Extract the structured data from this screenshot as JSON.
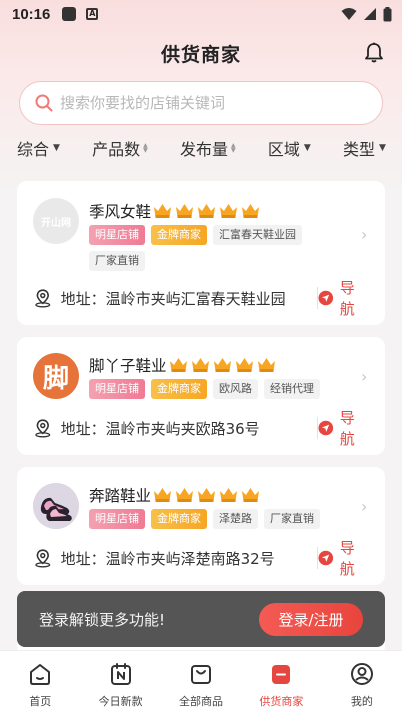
{
  "status_bar": {
    "time": "10:16"
  },
  "header": {
    "title": "供货商家"
  },
  "search": {
    "placeholder": "搜索你要找的店铺关键词"
  },
  "filters": [
    {
      "label": "综合",
      "indicator": "dropdown"
    },
    {
      "label": "产品数",
      "indicator": "sort"
    },
    {
      "label": "发布量",
      "indicator": "sort"
    },
    {
      "label": "区域",
      "indicator": "dropdown"
    },
    {
      "label": "类型",
      "indicator": "dropdown"
    }
  ],
  "shops": [
    {
      "name": "季风女鞋",
      "crowns": 5,
      "avatar_text": "开山网",
      "tags": [
        "明星店铺",
        "金牌商家",
        "汇富春天鞋业园",
        "厂家直销"
      ],
      "address_label": "地址：",
      "address": "温岭市夹屿汇富春天鞋业园",
      "nav_label": "导航"
    },
    {
      "name": "脚丫子鞋业",
      "crowns": 5,
      "avatar_text": "脚",
      "tags": [
        "明星店铺",
        "金牌商家",
        "欧风路",
        "经销代理"
      ],
      "address_label": "地址：",
      "address": "温岭市夹屿夹欧路36号",
      "nav_label": "导航"
    },
    {
      "name": "奔踏鞋业",
      "crowns": 5,
      "tags": [
        "明星店铺",
        "金牌商家",
        "泽楚路",
        "厂家直销"
      ],
      "address_label": "地址：",
      "address": "温岭市夹屿泽楚南路32号",
      "nav_label": "导航"
    }
  ],
  "toast": {
    "text": "登录解锁更多功能!",
    "button_label": "登录/注册"
  },
  "bottom_nav": [
    {
      "label": "首页",
      "icon": "home-icon"
    },
    {
      "label": "今日新款",
      "icon": "calendar-new-icon"
    },
    {
      "label": "全部商品",
      "icon": "shopping-bag-icon"
    },
    {
      "label": "供货商家",
      "icon": "supplier-icon",
      "active": true
    },
    {
      "label": "我的",
      "icon": "profile-icon"
    }
  ],
  "colors": {
    "accent": "#e5463f",
    "gold": "#f6a623",
    "star_tag": "#f07a95"
  }
}
